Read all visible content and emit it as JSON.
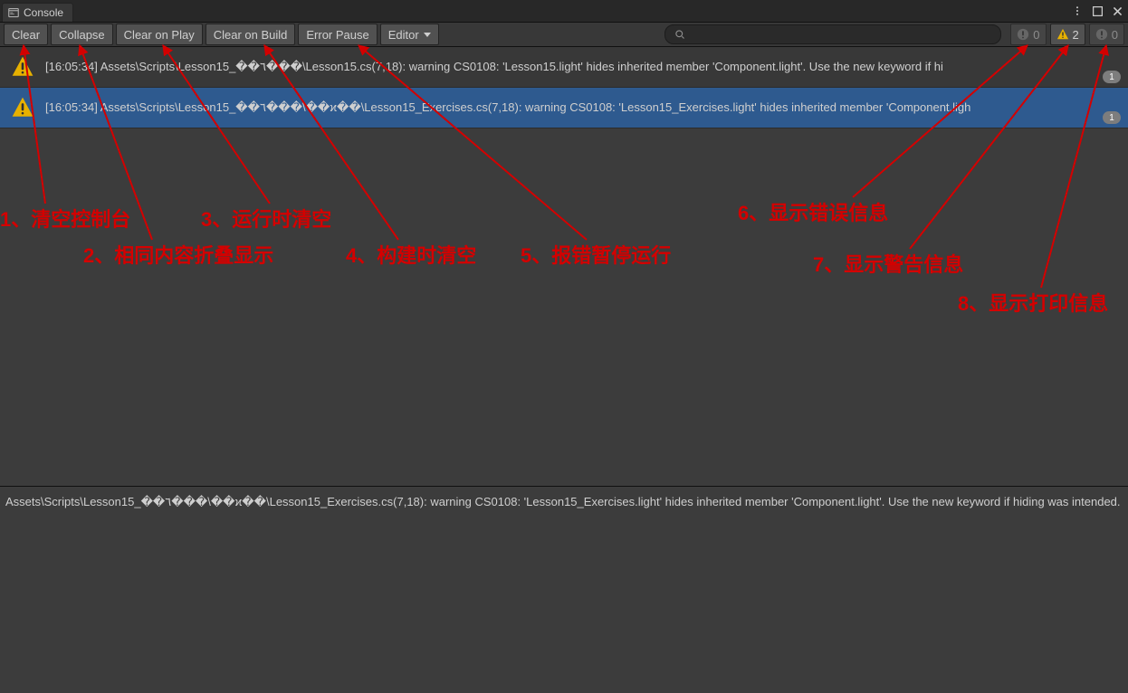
{
  "tab": {
    "title": "Console"
  },
  "toolbar": {
    "clear": "Clear",
    "collapse": "Collapse",
    "clearOnPlay": "Clear on Play",
    "clearOnBuild": "Clear on Build",
    "errorPause": "Error Pause",
    "editor": "Editor"
  },
  "search": {
    "placeholder": ""
  },
  "counters": {
    "errors": "0",
    "warnings": "2",
    "infos": "0"
  },
  "logs": [
    {
      "text": "[16:05:34] Assets\\Scripts\\Lesson15_��٦���\\Lesson15.cs(7,18): warning CS0108: 'Lesson15.light' hides inherited member 'Component.light'. Use the new keyword if hi",
      "count": "1",
      "selected": false
    },
    {
      "text": "[16:05:34] Assets\\Scripts\\Lesson15_��٦���\\��ϰ��\\Lesson15_Exercises.cs(7,18): warning CS0108: 'Lesson15_Exercises.light' hides inherited member 'Component.ligh",
      "count": "1",
      "selected": true
    }
  ],
  "details": {
    "text": "Assets\\Scripts\\Lesson15_��٦���\\��ϰ��\\Lesson15_Exercises.cs(7,18): warning CS0108: 'Lesson15_Exercises.light' hides inherited member 'Component.light'. Use the new keyword if hiding was intended."
  },
  "annotations": {
    "a1": "1、清空控制台",
    "a2": "2、相同内容折叠显示",
    "a3": "3、运行时清空",
    "a4": "4、构建时清空",
    "a5": "5、报错暂停运行",
    "a6": "6、显示错误信息",
    "a7": "7、显示警告信息",
    "a8": "8、显示打印信息"
  }
}
